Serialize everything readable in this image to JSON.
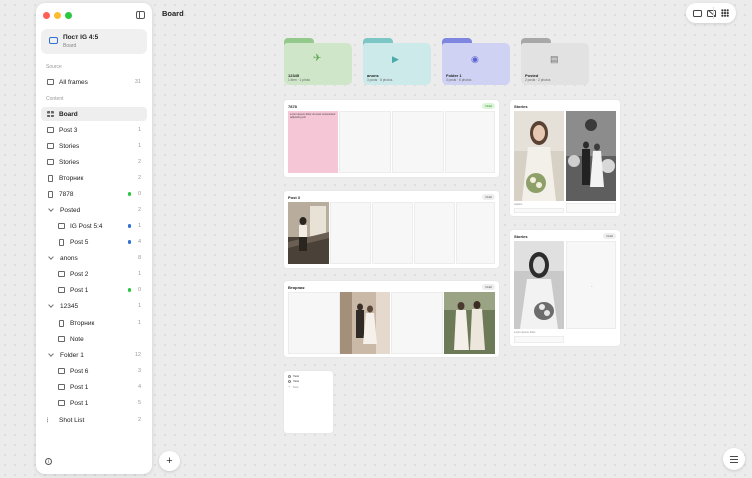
{
  "sidebar": {
    "project": {
      "title": "Пост IG 4:5",
      "subtitle": "Board"
    },
    "source_label": "Source",
    "content_label": "Content",
    "all_frames": {
      "label": "All frames",
      "count": "31"
    },
    "items": [
      {
        "label": "Board",
        "count": ""
      },
      {
        "label": "Post 3",
        "count": "1"
      },
      {
        "label": "Stories",
        "count": "1"
      },
      {
        "label": "Stories",
        "count": "2"
      },
      {
        "label": "Вторник",
        "count": "2"
      },
      {
        "label": "7878",
        "count": "0"
      },
      {
        "label": "Posted",
        "count": "2"
      },
      {
        "label": "IG Post 5:4",
        "count": "1"
      },
      {
        "label": "Post 5",
        "count": "4"
      },
      {
        "label": "anons",
        "count": "8"
      },
      {
        "label": "Post 2",
        "count": "1"
      },
      {
        "label": "Post 1",
        "count": "0"
      },
      {
        "label": "12345",
        "count": "1"
      },
      {
        "label": "Вторник",
        "count": "1"
      },
      {
        "label": "Note",
        "count": ""
      },
      {
        "label": "Folder 1",
        "count": "12"
      },
      {
        "label": "Post 6",
        "count": "3"
      },
      {
        "label": "Post 1",
        "count": "4"
      },
      {
        "label": "Post 1",
        "count": "5"
      },
      {
        "label": "Shot List",
        "count": "2"
      }
    ]
  },
  "header": {
    "title": "Board"
  },
  "folders": [
    {
      "name": "12345",
      "meta": "1 item · 1 photo",
      "color": "#cfe6c9",
      "tab_color": "#93c98b",
      "glyph_color": "#5aa650"
    },
    {
      "name": "anons",
      "meta": "3 posts · 8 photos",
      "color": "#cdeaea",
      "tab_color": "#7cc6c6",
      "glyph_color": "#4aa9a9"
    },
    {
      "name": "Folder 1",
      "meta": "3 posts · 6 photos",
      "color": "#cfd2f3",
      "tab_color": "#7e86e0",
      "glyph_color": "#5a63d0"
    },
    {
      "name": "Posted",
      "meta": "2 posts · 2 photos",
      "color": "#e2e2e2",
      "tab_color": "#a8a8a8",
      "glyph_color": "#6f6f6f"
    }
  ],
  "cards": {
    "c7878": {
      "title": "7878",
      "badge": "Draft",
      "note": "Lorem ipsum dolor sit amet consectetur adipiscing elit"
    },
    "post3": {
      "title": "Post 3",
      "badge": "Draft"
    },
    "vtornik": {
      "title": "Вторник",
      "badge": "Draft"
    },
    "stories1": {
      "title": "Stories",
      "badge": "Draft",
      "caption": "caption"
    },
    "stories2": {
      "title": "Stories",
      "badge": "Draft",
      "caption": "Lorem ipsum dolor"
    },
    "todo": {
      "items": [
        "Task",
        "Task",
        "Task"
      ]
    }
  },
  "colors": {
    "accent": "#2f6fd6",
    "dot_green": "#28c840",
    "dot_blue": "#2f6fd6"
  }
}
